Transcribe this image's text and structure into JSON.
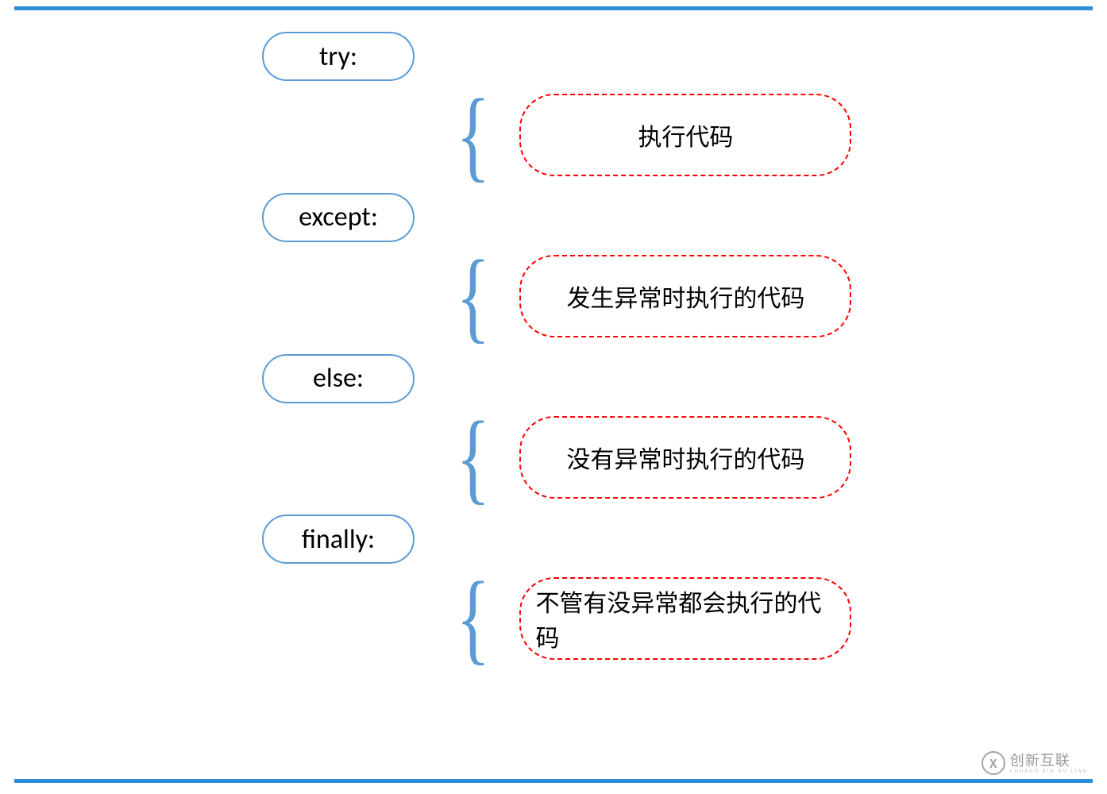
{
  "colors": {
    "border_blue": "#2b90d9",
    "box_blue": "#5b9bd5",
    "dash_red": "#ff0000"
  },
  "blocks": [
    {
      "keyword": "try:",
      "description": "执行代码"
    },
    {
      "keyword": "except:",
      "description": "发生异常时执行的代码"
    },
    {
      "keyword": "else:",
      "description": "没有异常时执行的代码"
    },
    {
      "keyword": "finally:",
      "description": "不管有没异常都会执行的代码"
    }
  ],
  "watermark": {
    "icon_letter": "X",
    "main": "创新互联",
    "sub": "CHUANG XIN HU LIAN"
  }
}
